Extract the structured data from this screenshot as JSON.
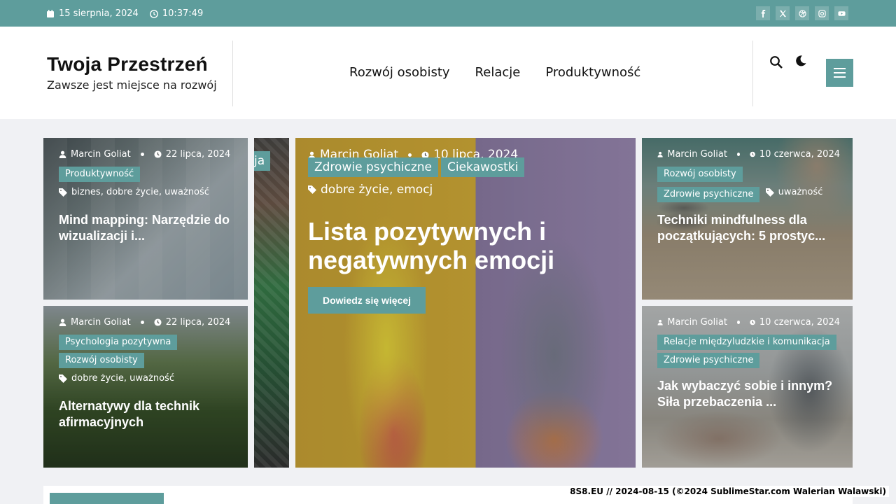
{
  "topbar": {
    "date": "15 sierpnia, 2024",
    "time": "10:37:49",
    "social": [
      "facebook-icon",
      "x-icon",
      "dribbble-icon",
      "instagram-icon",
      "youtube-icon"
    ]
  },
  "header": {
    "site_title": "Twoja Przestrzeń",
    "tagline": "Zawsze jest miejsce na rozwój",
    "nav": [
      "Rozwój osobisty",
      "Relacje",
      "Produktywność"
    ]
  },
  "colors": {
    "accent": "#5e9d9c"
  },
  "cards": {
    "c1": {
      "author": "Marcin Goliat",
      "date": "22 lipca, 2024",
      "cats": [
        "Produktywność"
      ],
      "tags": "biznes, dobre życie, uważność",
      "title": "Mind mapping: Narzędzie do wizualizacji i..."
    },
    "c2": {
      "author": "Marcin Goliat",
      "date": "22 lipca, 2024",
      "cats": [
        "Psychologia pozytywna",
        "Rozwój osobisty"
      ],
      "tags": "dobre życie, uważność",
      "title": "Alternatywy dla technik afirmacyjnych"
    },
    "big": {
      "author": "Marcin Goliat",
      "date": "10 lipca, 2024",
      "cats": [
        "Zdrowie psychiczne",
        "Ciekawostki"
      ],
      "tags": "dobre życie, emocj",
      "title": "Lista pozytywnych i negatywnych emocji",
      "button": "Dowiedz się więcej",
      "behind_cat": "ja"
    },
    "c3": {
      "author": "Marcin Goliat",
      "date": "10 czerwca, 2024",
      "cats": [
        "Rozwój osobisty",
        "Zdrowie psychiczne"
      ],
      "tags": "uważność",
      "title": "Techniki mindfulness dla początkujących: 5 prostyc..."
    },
    "c4": {
      "author": "Marcin Goliat",
      "date": "10 czerwca, 2024",
      "cats": [
        "Relacje międzyludzkie i komunikacja",
        "Zdrowie psychiczne"
      ],
      "tags": "",
      "title": "Jak wybaczyć sobie i innym? Siła przebaczenia ..."
    }
  },
  "watermark": "8S8.EU // 2024-08-15 (©2024 SublimeStar.com Walerian Walawski)"
}
